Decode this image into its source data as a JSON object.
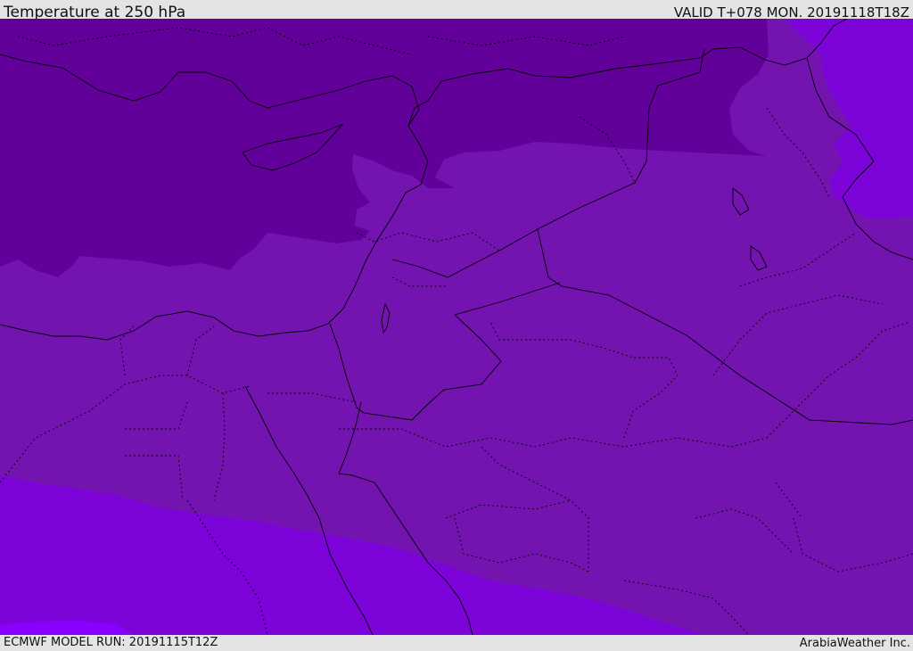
{
  "header": {
    "title": "Temperature at 250 hPa",
    "valid_time": "VALID T+078 MON. 20191118T18Z"
  },
  "footer": {
    "model_run": "ECMWF MODEL RUN: 20191115T12Z",
    "credit": "ArabiaWeather Inc."
  },
  "map": {
    "colors": {
      "coldest_band": "#62009a",
      "mid_band": "#7414b0",
      "warm_band": "#7d04d8",
      "warmest_band": "#8a00ff",
      "border_line": "#000000"
    }
  }
}
